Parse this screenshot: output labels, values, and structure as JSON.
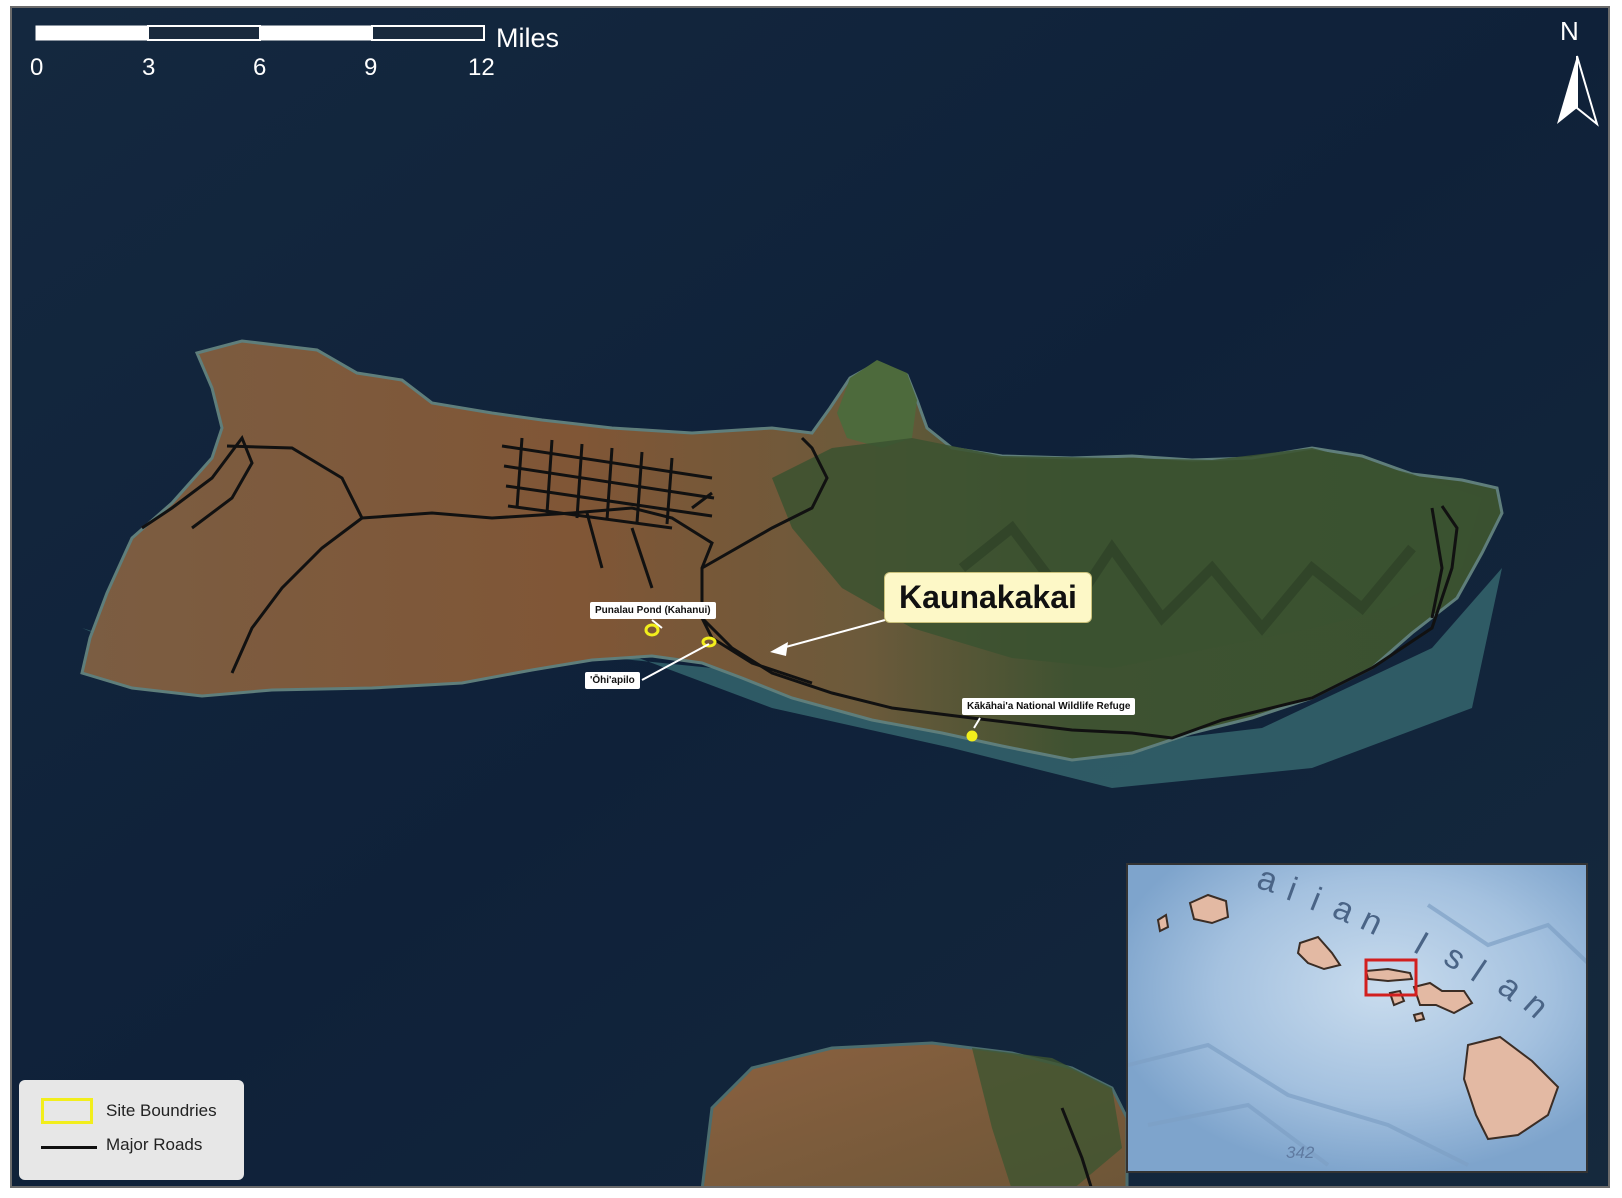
{
  "scale_bar": {
    "ticks": [
      "0",
      "3",
      "6",
      "9",
      "12"
    ],
    "unit": "Miles"
  },
  "north_arrow": {
    "label": "N",
    "icon": "north-arrow-icon"
  },
  "map": {
    "primary_label": "Kaunakakai",
    "site_labels": {
      "punalau": "Punalau Pond (Kahanui)",
      "ohiapilo": "'Ōhi'apilo",
      "kakahaia": "Kākāhai'a National Wildlife Refuge"
    }
  },
  "legend": {
    "items": [
      {
        "label": "Site Boundries",
        "symbol": "yellow-outline-box"
      },
      {
        "label": "Major Roads",
        "symbol": "black-line"
      }
    ]
  },
  "inset": {
    "chain_label_letters": [
      "a",
      "i",
      "i",
      "a",
      "n",
      "I",
      "s",
      "l",
      "a",
      "n"
    ],
    "depth_label": "342"
  },
  "colors": {
    "ocean": "#0f2139",
    "land_dry": "#7a5a3c",
    "land_forest": "#3b5230",
    "site_boundary": "#f2ee1c",
    "roads": "#111111",
    "inset_ocean": "#8fb1d6",
    "inset_land": "#e3b9a3",
    "inset_frame": "#d21f1f",
    "town_label_bg": "#fdf8c7"
  }
}
